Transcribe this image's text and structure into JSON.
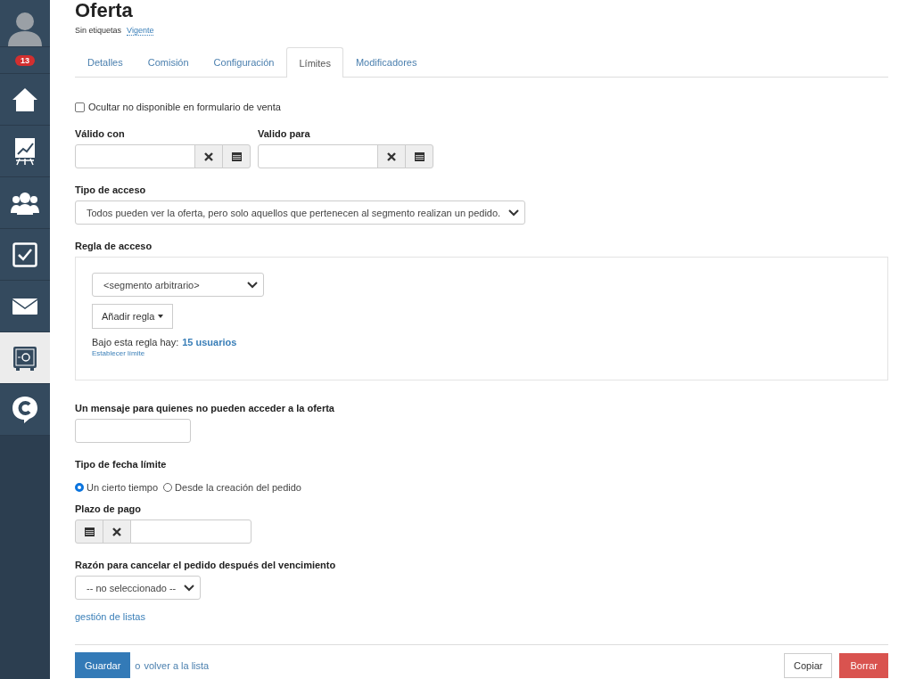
{
  "sidebar": {
    "badge": "13",
    "items": [
      {
        "kind": "home",
        "selected": false
      },
      {
        "kind": "chart",
        "selected": false
      },
      {
        "kind": "people",
        "selected": false
      },
      {
        "kind": "check",
        "selected": false
      },
      {
        "kind": "mail",
        "selected": false
      },
      {
        "kind": "safe",
        "selected": true
      },
      {
        "kind": "chat",
        "selected": false
      }
    ]
  },
  "header": {
    "title": "Oferta",
    "tags_label": "Sin etiquetas",
    "status_link": "Vigente"
  },
  "tabs": [
    {
      "label": "Detalles",
      "selected": false
    },
    {
      "label": "Comisión",
      "selected": false
    },
    {
      "label": "Configuración",
      "selected": false
    },
    {
      "label": "Límites",
      "selected": true
    },
    {
      "label": "Modificadores",
      "selected": false
    }
  ],
  "hide_unavailable": {
    "label": "Ocultar no disponible en formulario de venta",
    "checked": false
  },
  "valid_from": {
    "label": "Válido con"
  },
  "valid_to": {
    "label": "Valido para"
  },
  "access_type": {
    "label": "Tipo de acceso",
    "value": "Todos pueden ver la oferta, pero solo aquellos que pertenecen al segmento realizan un pedido."
  },
  "access_rule": {
    "label": "Regla de acceso",
    "segment": "<segmento arbitrario>",
    "add_rule_button": "Añadir regla",
    "users_text": "Bajo esta regla hay:",
    "users_link": "15 usuarios",
    "set_limit_link": "Establecer límite"
  },
  "message": {
    "label": "Un mensaje para quienes no pueden acceder a la oferta"
  },
  "deadline_type": {
    "label": "Tipo de fecha límite",
    "options": [
      {
        "label": "Un cierto tiempo",
        "selected": true
      },
      {
        "label": "Desde la creación del pedido",
        "selected": false
      }
    ]
  },
  "payment_term": {
    "label": "Plazo de pago"
  },
  "cancel_reason": {
    "label": "Razón para cancelar el pedido después del vencimiento",
    "value": "-- no seleccionado --"
  },
  "list_management_link": "gestión de listas",
  "footer": {
    "save_button": "Guardar",
    "or_text": "o",
    "back_link": "volver a la lista",
    "copy_button": "Copiar",
    "delete_button": "Borrar"
  }
}
